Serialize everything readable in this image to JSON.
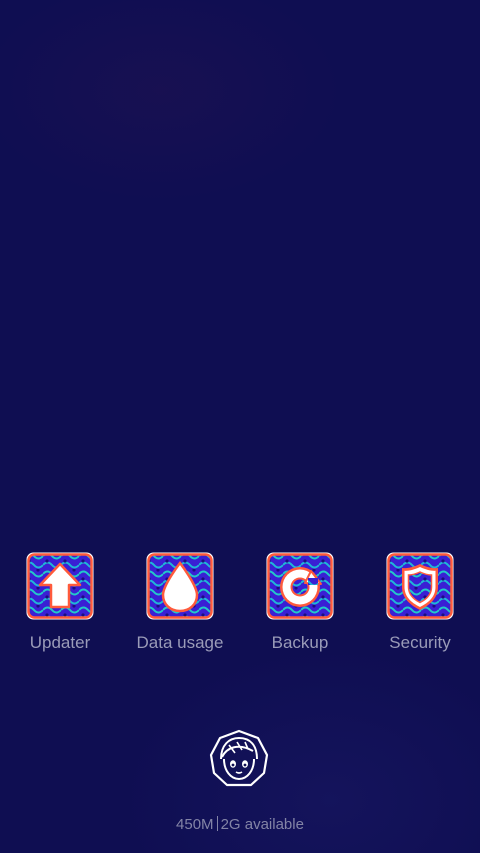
{
  "apps": [
    {
      "label": "Updater",
      "icon": "upload-arrow-icon"
    },
    {
      "label": "Data usage",
      "icon": "water-drop-icon"
    },
    {
      "label": "Backup",
      "icon": "refresh-circle-icon"
    },
    {
      "label": "Security",
      "icon": "shield-icon"
    }
  ],
  "mascot_icon": "boy-face-icon",
  "storage": {
    "used": "450M",
    "available": "2G available"
  },
  "colors": {
    "background": "#0f0e52",
    "icon_fill": "#3a1fd4",
    "icon_pattern": "#22c9c9",
    "icon_border": "#ff5a3c",
    "label_text": "#9a9bb8"
  }
}
